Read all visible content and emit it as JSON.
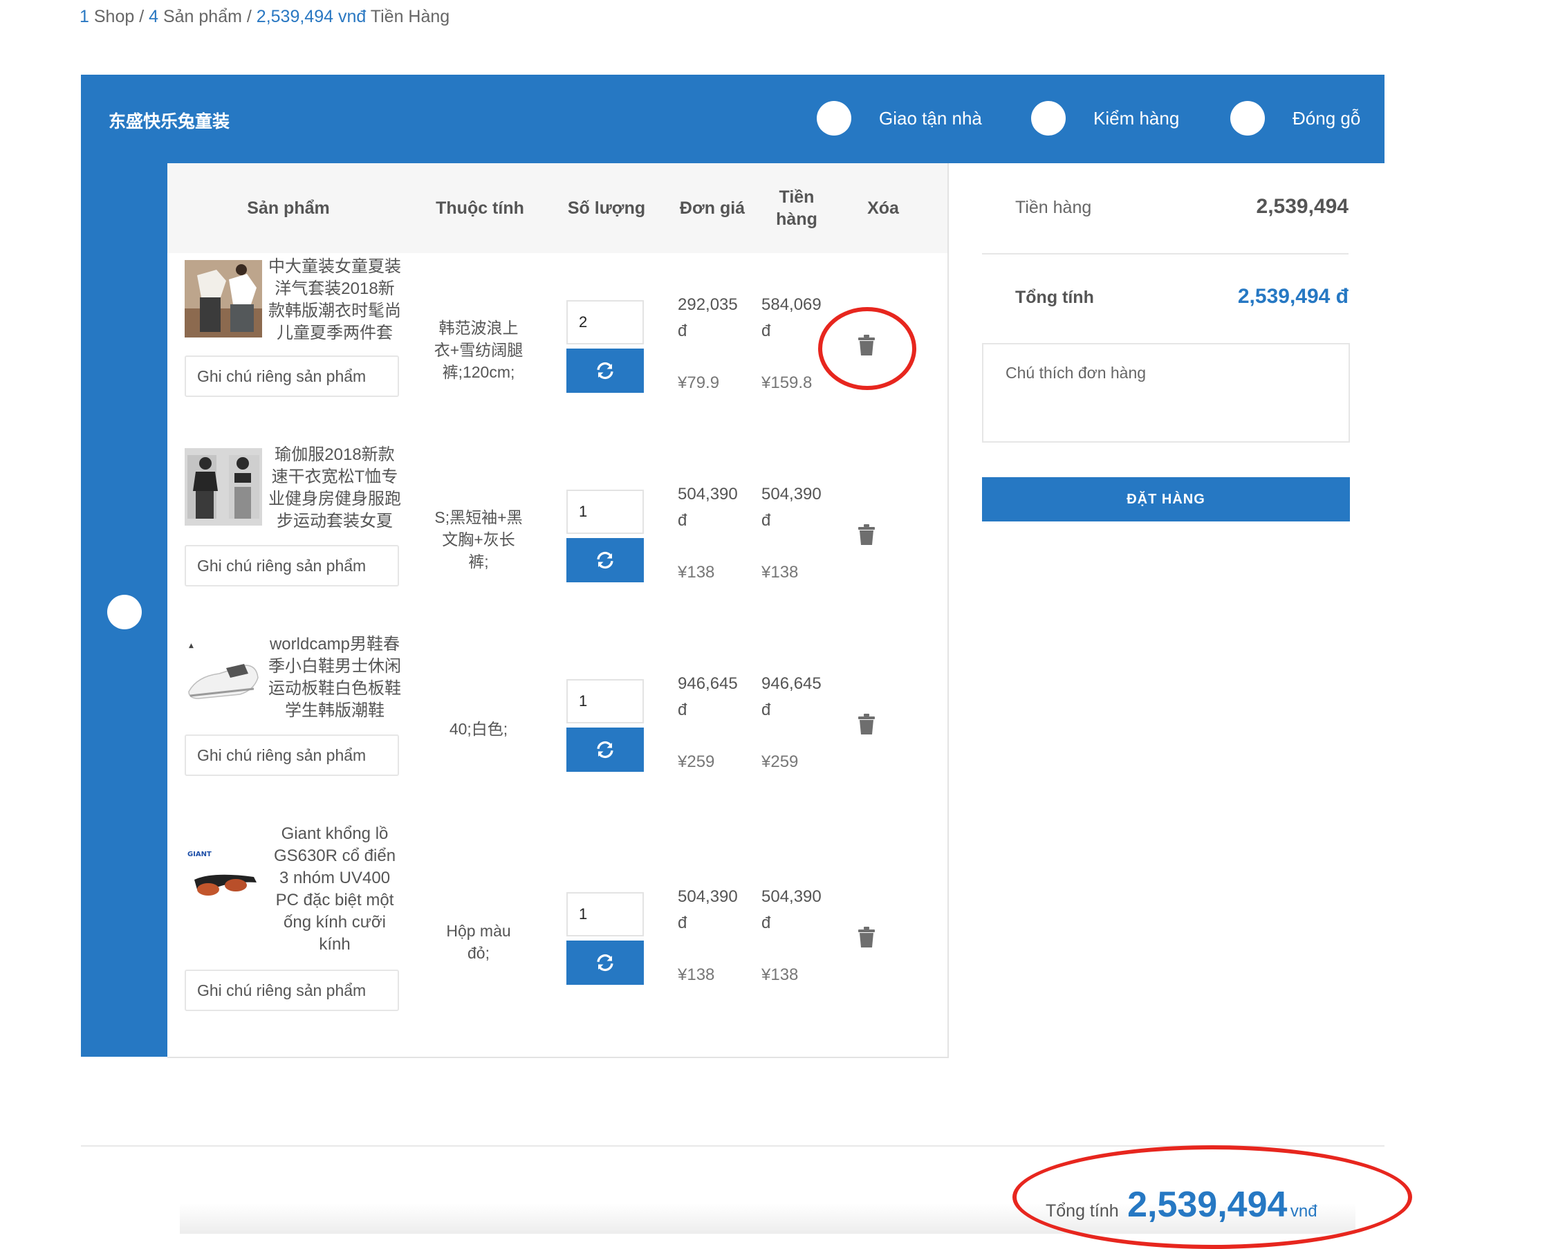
{
  "breadcrumb": {
    "shop_count": "1",
    "shop_label": "Shop",
    "sep1": "/",
    "product_count": "4",
    "product_label": "Sản phẩm",
    "sep2": "/",
    "amount": "2,539,494 vnđ",
    "amount_label": "Tiền Hàng"
  },
  "shop": {
    "name": "东盛快乐兔童装",
    "options": [
      "Giao tận nhà",
      "Kiểm hàng",
      "Đóng gỗ"
    ]
  },
  "table": {
    "headers": {
      "product": "Sản phẩm",
      "attribute": "Thuộc tính",
      "quantity": "Số lượng",
      "unit_price": "Đơn giá",
      "line_total_1": "Tiền",
      "line_total_2": "hàng",
      "delete": "Xóa"
    },
    "note_placeholder": "Ghi chú riêng sản phẩm",
    "rows": [
      {
        "name_lines": [
          "中大童装女童夏装",
          "洋气套装2018新",
          "款韩版潮衣时髦尚",
          "儿童夏季两件套"
        ],
        "attr_lines": [
          "韩范波浪上",
          "衣+雪纺阔腿",
          "裤;120cm;"
        ],
        "quantity": "2",
        "unit_vnd": "292,035",
        "total_vnd": "584,069",
        "currency": "đ",
        "unit_cny": "¥79.9",
        "total_cny": "¥159.8"
      },
      {
        "name_lines": [
          "瑜伽服2018新款",
          "速干衣宽松T恤专",
          "业健身房健身服跑",
          "步运动套装女夏"
        ],
        "attr_lines": [
          "S;黑短袖+黑",
          "文胸+灰长",
          "裤;"
        ],
        "quantity": "1",
        "unit_vnd": "504,390",
        "total_vnd": "504,390",
        "currency": "đ",
        "unit_cny": "¥138",
        "total_cny": "¥138"
      },
      {
        "name_lines": [
          "worldcamp男鞋春",
          "季小白鞋男士休闲",
          "运动板鞋白色板鞋",
          "学生韩版潮鞋"
        ],
        "attr_lines": [
          "40;白色;"
        ],
        "quantity": "1",
        "unit_vnd": "946,645",
        "total_vnd": "946,645",
        "currency": "đ",
        "unit_cny": "¥259",
        "total_cny": "¥259"
      },
      {
        "name_lines": [
          "Giant khổng lồ",
          "GS630R cổ điển",
          "3 nhóm UV400",
          "PC đặc biệt một",
          "ống kính cưỡi",
          "kính"
        ],
        "attr_lines": [
          "Hộp màu",
          "đỏ;"
        ],
        "quantity": "1",
        "unit_vnd": "504,390",
        "total_vnd": "504,390",
        "currency": "đ",
        "unit_cny": "¥138",
        "total_cny": "¥138"
      }
    ]
  },
  "summary": {
    "goods_label": "Tiền hàng",
    "goods_value": "2,539,494",
    "total_label": "Tổng tính",
    "total_value": "2,539,494 đ",
    "note_placeholder": "Chú thích đơn hàng",
    "order_button": "ĐẶT HÀNG"
  },
  "bottom": {
    "label": "Tổng tính",
    "value": "2,539,494",
    "unit": "vnđ"
  },
  "colors": {
    "brand_blue": "#2678c3",
    "annotation_red": "#e7261e"
  },
  "icons": [
    "trash-icon",
    "refresh-icon"
  ]
}
